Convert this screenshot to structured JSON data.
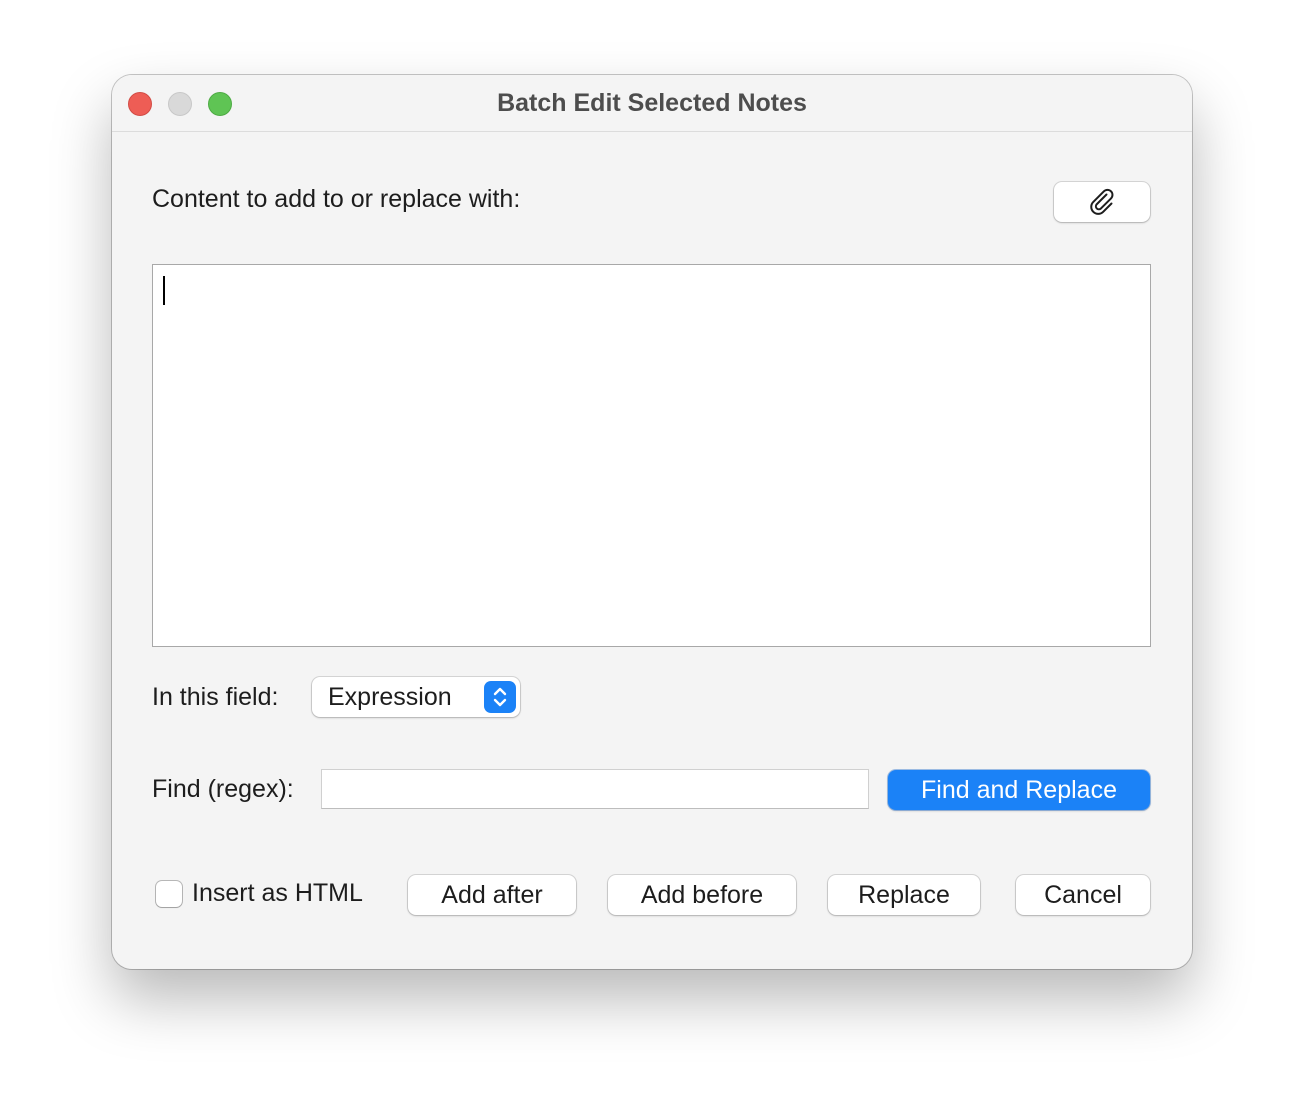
{
  "window": {
    "title": "Batch Edit Selected Notes"
  },
  "content": {
    "label": "Content to add to or replace with:",
    "attach_icon": "paperclip-icon",
    "text_value": ""
  },
  "field": {
    "label": "In this field:",
    "selected": "Expression",
    "stepper_icon": "up-down-chevron-icon"
  },
  "find": {
    "label": "Find (regex):",
    "value": "",
    "button_label": "Find and Replace"
  },
  "options": {
    "insert_html_label": "Insert as HTML",
    "insert_html_checked": false
  },
  "actions": {
    "add_after": "Add after",
    "add_before": "Add before",
    "replace": "Replace",
    "cancel": "Cancel"
  },
  "colors": {
    "accent": "#1b82f7",
    "close": "#ee5d55",
    "zoom": "#5fc454"
  }
}
